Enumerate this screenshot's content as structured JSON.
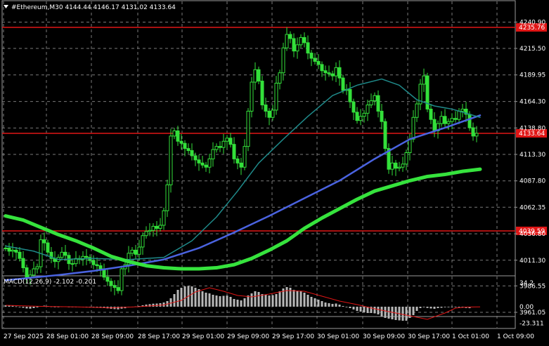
{
  "header": {
    "symbol_line": "#Ethereum,M30  4144.44 4146.17 4131.02 4133.64",
    "menu_icon": "triangle-down-icon"
  },
  "colors": {
    "background": "#000000",
    "grid": "#7a7a7a",
    "candle": "#33e03a",
    "ma_fast": "#1f8a8a",
    "ma_mid": "#4a63e0",
    "ma_slow": "#36e33d",
    "level_line": "#e01515",
    "macd_hist": "#b8b8b8",
    "macd_signal": "#e01515",
    "price_tag": "#e01515"
  },
  "chart_data": [
    {
      "type": "candlestick",
      "title": "#Ethereum,M30",
      "ohlc_last": {
        "open": 4144.44,
        "high": 4146.17,
        "low": 4131.02,
        "close": 4133.64
      },
      "x_ticks": [
        "27 Sep 2025",
        "28 Sep 01:00",
        "28 Sep 09:00",
        "28 Sep 17:00",
        "29 Sep 01:00",
        "29 Sep 09:00",
        "29 Sep 17:00",
        "30 Sep 01:00",
        "30 Sep 09:00",
        "30 Sep 17:00",
        "1 Oct 01:00",
        "1 Oct 09:00"
      ],
      "y_ticks": [
        "4240.90",
        "4215.50",
        "4189.95",
        "4164.30",
        "4138.80",
        "4113.30",
        "4087.80",
        "4062.35",
        "4036.80",
        "4011.30",
        "3986.55",
        "3961.05"
      ],
      "ylim": [
        3957.0,
        4250.0
      ],
      "grid": true,
      "levels": [
        {
          "label": "4235.76",
          "value": 4235.76
        },
        {
          "label": "4133.64",
          "value": 4133.64
        },
        {
          "label": "4039.59",
          "value": 4039.59
        }
      ],
      "close_series": [
        4023,
        4020,
        4021,
        4019,
        4013,
        4004,
        3995,
        3997,
        4003,
        4005,
        4031,
        4028,
        4019,
        4013,
        4010,
        4014,
        4019,
        4016,
        4008,
        4008,
        4013,
        4012,
        4015,
        4014,
        4011,
        4007,
        4006,
        4003,
        3995,
        3991,
        3987,
        3985,
        3982,
        4003,
        4007,
        4018,
        4021,
        4017,
        4024,
        4035,
        4039,
        4040,
        4044,
        4042,
        4045,
        4059,
        4084,
        4131,
        4136,
        4126,
        4124,
        4119,
        4117,
        4112,
        4108,
        4105,
        4103,
        4101,
        4109,
        4118,
        4121,
        4120,
        4126,
        4129,
        4123,
        4109,
        4105,
        4101,
        4121,
        4155,
        4183,
        4195,
        4184,
        4161,
        4155,
        4149,
        4156,
        4182,
        4192,
        4216,
        4229,
        4225,
        4213,
        4219,
        4226,
        4221,
        4211,
        4206,
        4203,
        4200,
        4194,
        4192,
        4191,
        4189,
        4197,
        4187,
        4175,
        4176,
        4164,
        4154,
        4146,
        4150,
        4153,
        4161,
        4165,
        4170,
        4155,
        4145,
        4119,
        4099,
        4105,
        4100,
        4101,
        4104,
        4115,
        4128,
        4149,
        4162,
        4181,
        4189,
        4157,
        4147,
        4136,
        4143,
        4150,
        4143,
        4145,
        4148,
        4147,
        4155,
        4157,
        4152,
        4139,
        4131,
        4133.64
      ],
      "series": [
        {
          "name": "",
          "kind": "ma",
          "points": [
            [
              0,
              3992
            ],
            [
              15,
              3997
            ],
            [
              25,
              4001
            ],
            [
              35,
              4006
            ],
            [
              45,
              4012
            ],
            [
              55,
              4023
            ],
            [
              65,
              4038
            ],
            [
              75,
              4054
            ],
            [
              85,
              4071
            ],
            [
              95,
              4088
            ],
            [
              105,
              4109
            ],
            [
              115,
              4128
            ],
            [
              125,
              4139
            ],
            [
              135,
              4151
            ]
          ]
        },
        {
          "name": "",
          "kind": "ma",
          "points": [
            [
              0,
              4025
            ],
            [
              8,
              4020
            ],
            [
              15,
              4012
            ],
            [
              25,
              4013
            ],
            [
              35,
              4012
            ],
            [
              45,
              4014
            ],
            [
              53,
              4030
            ],
            [
              60,
              4053
            ],
            [
              66,
              4078
            ],
            [
              72,
              4105
            ],
            [
              79,
              4128
            ],
            [
              86,
              4150
            ],
            [
              93,
              4170
            ],
            [
              100,
              4180
            ],
            [
              107,
              4186
            ],
            [
              112,
              4180
            ],
            [
              117,
              4166
            ],
            [
              122,
              4160
            ],
            [
              127,
              4157
            ],
            [
              131,
              4153
            ],
            [
              135,
              4149
            ]
          ]
        },
        {
          "name": "",
          "kind": "ma",
          "points": [
            [
              0,
              4054
            ],
            [
              5,
              4050
            ],
            [
              10,
              4043
            ],
            [
              15,
              4036
            ],
            [
              20,
              4030
            ],
            [
              25,
              4023
            ],
            [
              30,
              4015
            ],
            [
              35,
              4010
            ],
            [
              40,
              4006
            ],
            [
              45,
              4004
            ],
            [
              50,
              4003
            ],
            [
              55,
              4003
            ],
            [
              60,
              4004
            ],
            [
              65,
              4007
            ],
            [
              70,
              4013
            ],
            [
              75,
              4021
            ],
            [
              80,
              4030
            ],
            [
              85,
              4042
            ],
            [
              90,
              4052
            ],
            [
              95,
              4061
            ],
            [
              100,
              4070
            ],
            [
              105,
              4078
            ],
            [
              110,
              4083
            ],
            [
              115,
              4088
            ],
            [
              120,
              4092
            ],
            [
              125,
              4094
            ],
            [
              130,
              4097
            ],
            [
              135,
              4099
            ]
          ]
        }
      ]
    },
    {
      "type": "bar",
      "title": "MACD(12,26,9) -2.102 -0.201",
      "y_ticks": [
        "34.2",
        "0.00",
        "-23.311"
      ],
      "ylim": [
        -28.0,
        38.0
      ],
      "grid": true,
      "histogram": [
        2,
        1.8,
        1.2,
        0.5,
        -0.5,
        -1.5,
        -2.5,
        -2.8,
        -2,
        -1,
        1,
        1.5,
        1,
        0.3,
        -0.2,
        0,
        0.4,
        0.3,
        -0.3,
        -0.6,
        -0.4,
        -0.5,
        -0.2,
        -0.1,
        -0.4,
        -0.8,
        -1,
        -1.2,
        -1.8,
        -2.4,
        -3,
        -3.4,
        -3.8,
        -2.8,
        -2.2,
        -1,
        0,
        0.4,
        1,
        2,
        3,
        3.6,
        4.3,
        4.5,
        5,
        6,
        8,
        12,
        18,
        24,
        27,
        29,
        29.5,
        29,
        27,
        25,
        22,
        20,
        19,
        17,
        16,
        15,
        15.5,
        15.8,
        14,
        11,
        10,
        9,
        12,
        16,
        19,
        22,
        21,
        18,
        17,
        16,
        16.5,
        18,
        22,
        26,
        28,
        27,
        24,
        23,
        22,
        20,
        17,
        14,
        12,
        10,
        8,
        6,
        5,
        4,
        4.5,
        3,
        1,
        0,
        -2,
        -4,
        -6,
        -7,
        -8,
        -9,
        -9,
        -9.5,
        -11,
        -14,
        -16,
        -17,
        -18,
        -19,
        -19.5,
        -20,
        -20,
        -16,
        -12,
        -6,
        -2,
        0,
        -1.8,
        -2.5,
        -3,
        -2,
        -1.5,
        -0.5,
        -0.2,
        0,
        0.1,
        -0.3,
        -1,
        -1.8,
        -2.1
      ],
      "signal": [
        [
          0,
          2
        ],
        [
          10,
          0.5
        ],
        [
          20,
          -0.3
        ],
        [
          30,
          -1.6
        ],
        [
          38,
          0
        ],
        [
          45,
          2.5
        ],
        [
          50,
          9
        ],
        [
          54,
          21
        ],
        [
          58,
          27
        ],
        [
          62,
          22
        ],
        [
          66,
          16
        ],
        [
          70,
          14
        ],
        [
          75,
          18
        ],
        [
          80,
          23
        ],
        [
          85,
          22
        ],
        [
          90,
          15
        ],
        [
          95,
          8
        ],
        [
          100,
          3
        ],
        [
          105,
          -3
        ],
        [
          110,
          -8
        ],
        [
          115,
          -13
        ],
        [
          120,
          -18
        ],
        [
          125,
          -9
        ],
        [
          128,
          -2
        ],
        [
          131,
          -0.5
        ],
        [
          135,
          -0.2
        ]
      ]
    }
  ]
}
